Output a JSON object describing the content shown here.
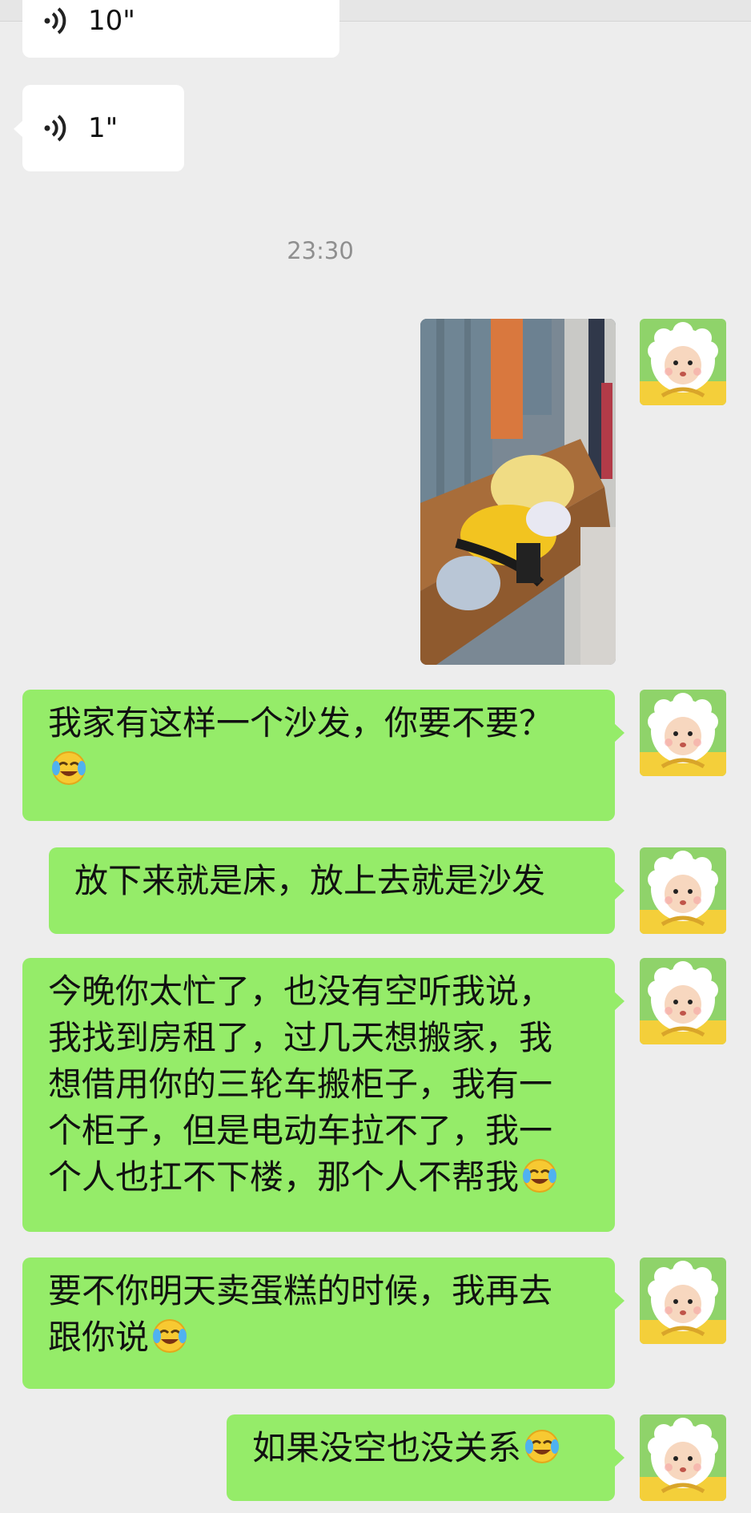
{
  "chat": {
    "voice_messages": [
      {
        "duration": "10\""
      },
      {
        "duration": "1\""
      }
    ],
    "timestamp": "23:30",
    "messages": [
      {
        "type": "image",
        "content": "photo"
      },
      {
        "type": "text",
        "lines": [
          "我家有这样一个沙发，你要不要？"
        ],
        "emoji": "face-with-tears-of-joy"
      },
      {
        "type": "text",
        "lines": [
          "放下来就是床，放上去就是沙发"
        ]
      },
      {
        "type": "text",
        "lines": [
          "今晚你太忙了，也没有空听我说，",
          "我找到房租了，过几天想搬家，我",
          "想借用你的三轮车搬柜子，我有一",
          "个柜子，但是电动车拉不了，我一",
          "个人也扛不下楼，那个人不帮我"
        ],
        "emoji": "face-with-tears-of-joy"
      },
      {
        "type": "text",
        "lines": [
          "要不你明天卖蛋糕的时候，我再去",
          "跟你说"
        ],
        "emoji": "face-with-tears-of-joy"
      },
      {
        "type": "text",
        "lines": [
          "如果没空也没关系"
        ],
        "emoji": "face-with-tears-of-joy"
      }
    ]
  },
  "colors": {
    "background": "#ededed",
    "sent_bubble": "#95ec69",
    "received_bubble": "#ffffff",
    "timestamp_text": "#8f8f8f"
  }
}
